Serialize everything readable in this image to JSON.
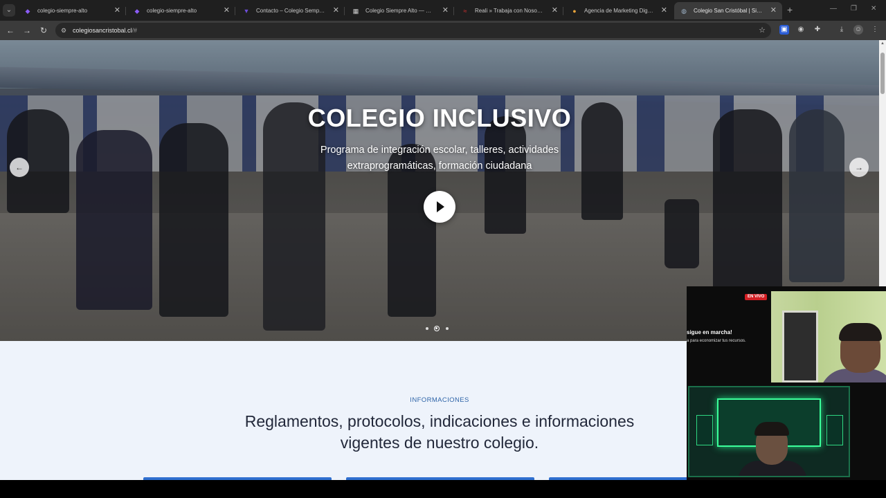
{
  "browser": {
    "tabs": [
      {
        "title": "colegio-siempre-alto",
        "favicon": "purple-bolt-icon",
        "favicon_color": "#8b5cf6",
        "active": false
      },
      {
        "title": "colegio-siempre-alto",
        "favicon": "purple-bolt-icon",
        "favicon_color": "#8b5cf6",
        "active": false
      },
      {
        "title": "Contacto – Colegio Semper Alto",
        "favicon": "wp-blue-icon",
        "favicon_color": "#6d4cd8",
        "active": false
      },
      {
        "title": "Colegio Siempre Alto — Especialistas",
        "favicon": "building-icon",
        "favicon_color": "#cfcfcf",
        "active": false
      },
      {
        "title": "Reali » Trabaja con Nosotros",
        "favicon": "reali-icon",
        "favicon_color": "#e03131",
        "active": false
      },
      {
        "title": "Agencia de Marketing Digital -",
        "favicon": "shield-icon",
        "favicon_color": "#e8a33a",
        "active": false
      },
      {
        "title": "Colegio San Cristóbal | Sitio Oficial",
        "favicon": "globe-icon",
        "favicon_color": "#9fb4c8",
        "active": true
      }
    ],
    "url_host": "colegiosancristobal.cl",
    "url_path": "/#"
  },
  "hero": {
    "title": "COLEGIO INCLUSIVO",
    "subtitle": "Programa de integración escolar, talleres, actividades extraprogramáticas, formación ciudadana",
    "active_slide": 2,
    "slide_count": 3
  },
  "info": {
    "kicker": "INFORMACIONES",
    "heading": "Reglamentos, protocolos, indicaciones e informaciones vigentes de nuestro colegio."
  },
  "overlay": {
    "live_badge": "EN VIVO",
    "line1": "sigue en marcha!",
    "line2": "a para economizar tus recursos."
  },
  "colors": {
    "accent": "#2f6fcf",
    "kicker": "#2e64a8",
    "heading": "#22283a",
    "section_bg": "#eef3fb",
    "live_red": "#d31f24"
  }
}
